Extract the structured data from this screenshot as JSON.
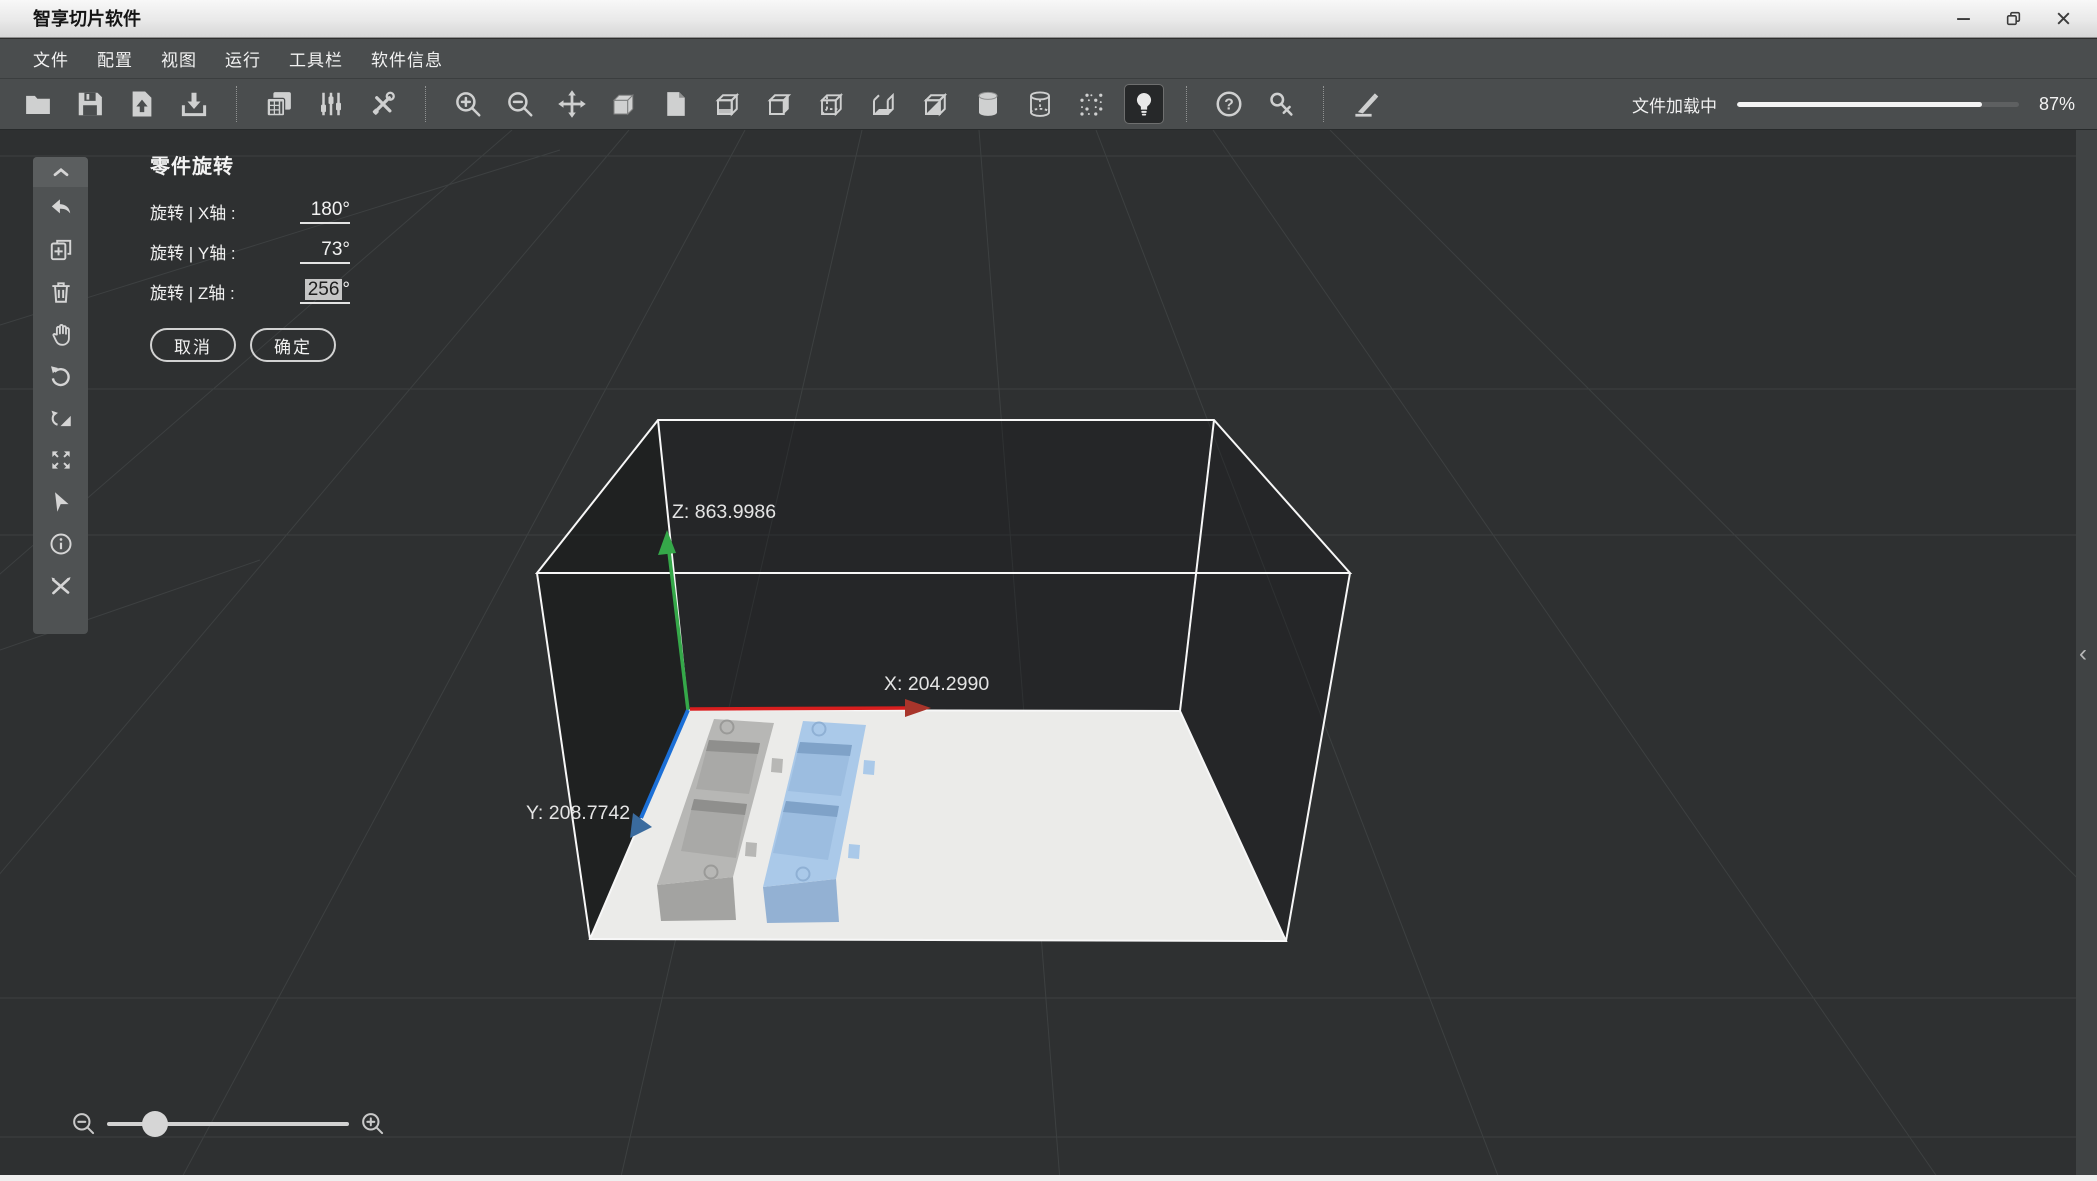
{
  "window": {
    "title": "智享切片软件",
    "controls": [
      {
        "name": "minimize"
      },
      {
        "name": "restore"
      },
      {
        "name": "close"
      }
    ]
  },
  "menu": {
    "items": [
      "文件",
      "配置",
      "视图",
      "运行",
      "工具栏",
      "软件信息"
    ]
  },
  "toolbar": {
    "items": [
      {
        "name": "open-file"
      },
      {
        "name": "save-file"
      },
      {
        "name": "import-model"
      },
      {
        "name": "export-model"
      },
      {
        "name": "separator"
      },
      {
        "name": "machine-settings"
      },
      {
        "name": "parameter-sliders"
      },
      {
        "name": "tools"
      },
      {
        "name": "separator"
      },
      {
        "name": "zoom-in"
      },
      {
        "name": "zoom-out"
      },
      {
        "name": "move-model"
      },
      {
        "name": "cube-solid"
      },
      {
        "name": "page"
      },
      {
        "name": "box-glass"
      },
      {
        "name": "cube-face-right"
      },
      {
        "name": "cube-wireframe"
      },
      {
        "name": "box-bottom"
      },
      {
        "name": "cube-half"
      },
      {
        "name": "cylinder-solid"
      },
      {
        "name": "cylinder-wireframe"
      },
      {
        "name": "cube-points"
      },
      {
        "name": "light",
        "active": true
      },
      {
        "name": "separator"
      },
      {
        "name": "help"
      },
      {
        "name": "license-key"
      },
      {
        "name": "separator"
      },
      {
        "name": "slice-knife"
      }
    ],
    "loading": {
      "label": "文件加载中",
      "percent": 87,
      "percent_label": "87%"
    }
  },
  "sidebar": {
    "items": [
      {
        "name": "collapse-up"
      },
      {
        "name": "undo"
      },
      {
        "name": "duplicate"
      },
      {
        "name": "delete"
      },
      {
        "name": "pan-hand"
      },
      {
        "name": "rotate"
      },
      {
        "name": "mirror"
      },
      {
        "name": "fit-view"
      },
      {
        "name": "select-cursor"
      },
      {
        "name": "info"
      },
      {
        "name": "repair-tools"
      }
    ]
  },
  "rotate_panel": {
    "title": "零件旋转",
    "rows": [
      {
        "axis": "X",
        "label": "旋转 | X轴 :",
        "value": "180",
        "unit": "°",
        "selected": false
      },
      {
        "axis": "Y",
        "label": "旋转 | Y轴 :",
        "value": "73",
        "unit": "°",
        "selected": false
      },
      {
        "axis": "Z",
        "label": "旋转 | Z轴 :",
        "value": "256",
        "unit": "°",
        "selected": true
      }
    ],
    "cancel_label": "取消",
    "confirm_label": "确定"
  },
  "scene": {
    "axis_labels": {
      "z": "Z:  863.9986",
      "x": "X: 204.2990",
      "y": "Y:  208.7742"
    },
    "colors": {
      "x_axis": "#d81e1e",
      "y_axis": "#1b6fd6",
      "z_axis": "#35a849",
      "plate": "#ebebe9",
      "model_gray": "#b7b7b5",
      "model_blue": "#aac9e9",
      "background": "#2e3031"
    },
    "models": [
      {
        "name": "tray-gray",
        "color": "#b7b7b5"
      },
      {
        "name": "tray-blue",
        "color": "#aac9e9"
      }
    ]
  },
  "zoom_control": {
    "percent": 20
  },
  "right_panel_toggle": {
    "glyph": "‹"
  }
}
